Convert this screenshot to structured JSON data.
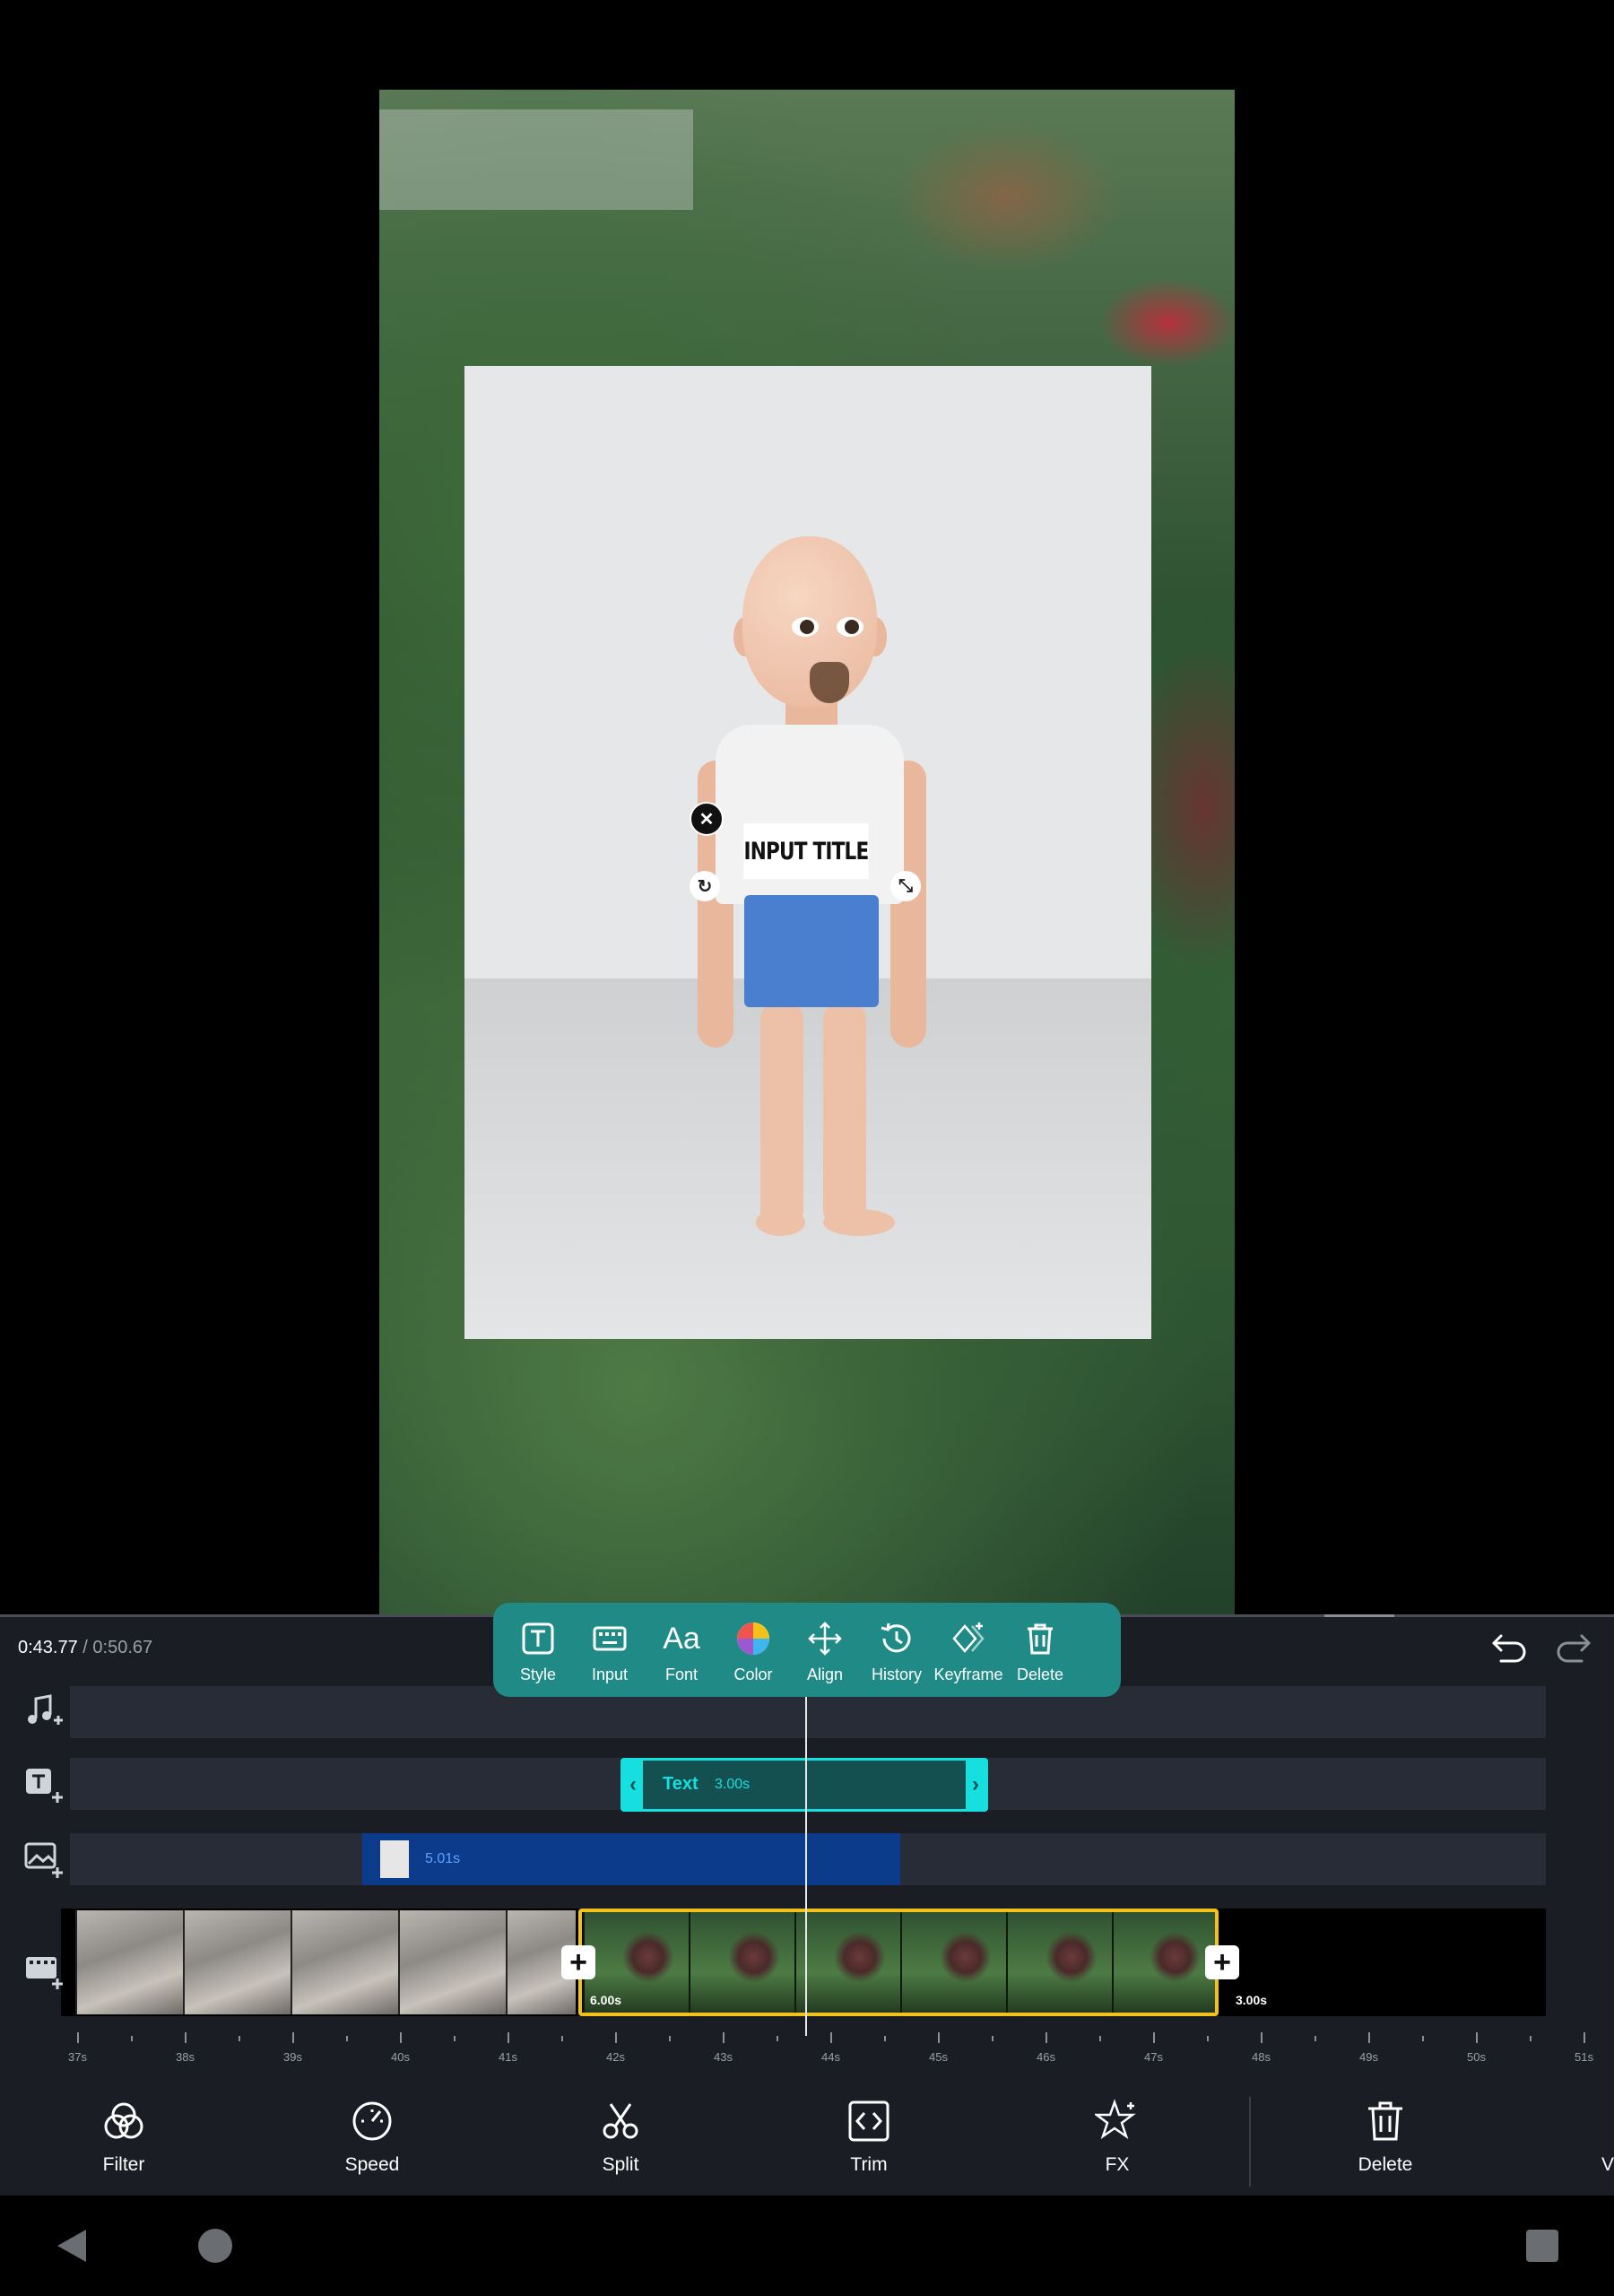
{
  "preview": {
    "overlay_text": "INPUT TITLE"
  },
  "timeline": {
    "current_time": "0:43.77",
    "separator": " / ",
    "total_time": "0:50.67",
    "text_clip": {
      "label": "Text",
      "duration": "3.00s"
    },
    "overlay_clip": {
      "duration": "5.01s"
    },
    "selected_clip_duration": "6.00s",
    "next_clip_duration": "3.00s",
    "ruler_labels": [
      "37s",
      "38s",
      "39s",
      "40s",
      "41s",
      "42s",
      "43s",
      "44s",
      "45s",
      "46s",
      "47s",
      "48s",
      "49s",
      "50s",
      "51s"
    ]
  },
  "text_toolbar": {
    "items": [
      {
        "label": "Style",
        "icon": "text-style-icon"
      },
      {
        "label": "Input",
        "icon": "keyboard-icon"
      },
      {
        "label": "Font",
        "icon": "font-icon"
      },
      {
        "label": "Color",
        "icon": "color-wheel-icon"
      },
      {
        "label": "Align",
        "icon": "move-arrows-icon"
      },
      {
        "label": "History",
        "icon": "history-icon"
      },
      {
        "label": "Keyframe",
        "icon": "keyframe-icon"
      },
      {
        "label": "Delete",
        "icon": "trash-icon"
      }
    ],
    "font_glyph": "Aa"
  },
  "bottom_actions": {
    "items": [
      {
        "label": "Filter",
        "icon": "filter-icon"
      },
      {
        "label": "Speed",
        "icon": "speedometer-icon"
      },
      {
        "label": "Split",
        "icon": "scissors-icon"
      },
      {
        "label": "Trim",
        "icon": "trim-icon"
      },
      {
        "label": "FX",
        "icon": "sparkle-icon"
      },
      {
        "label": "Delete",
        "icon": "trash-icon"
      }
    ],
    "partial_label": "V"
  },
  "colors": {
    "toolbar_bg": "#1f8a86",
    "text_clip_accent": "#16dfe0",
    "selected_clip_border": "#f2c21b",
    "overlay_clip": "#0b3b8a"
  }
}
